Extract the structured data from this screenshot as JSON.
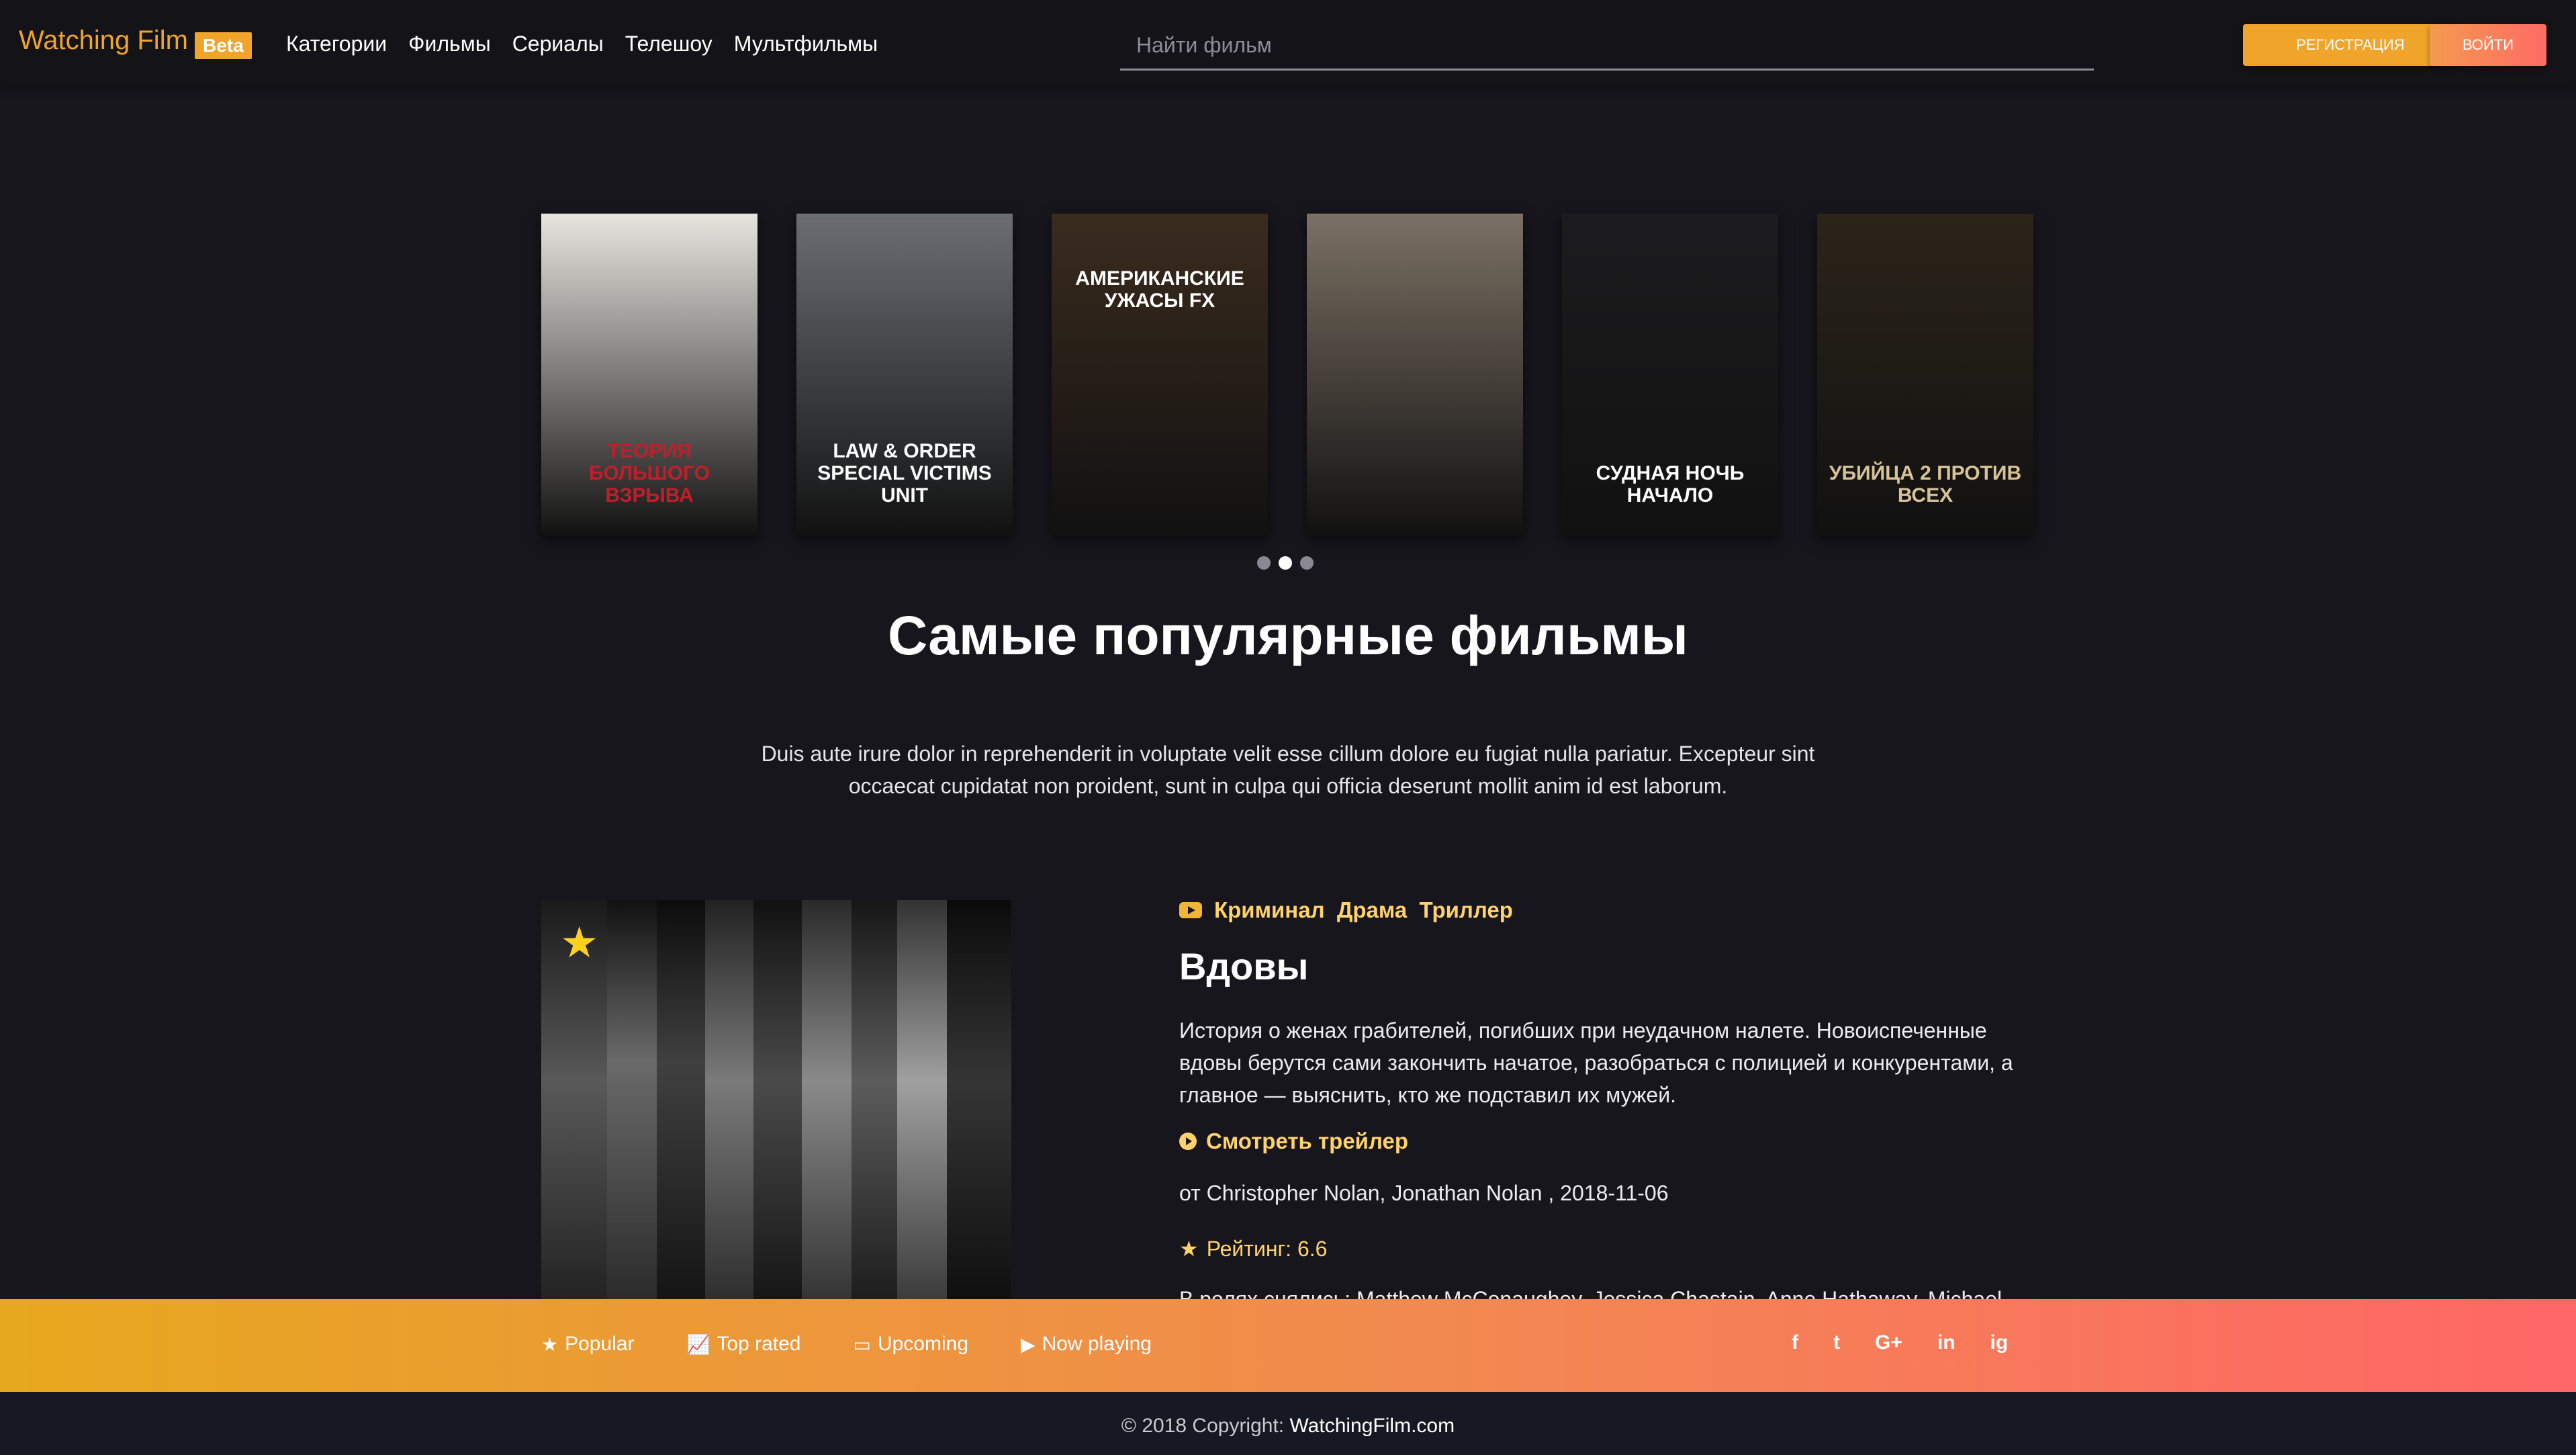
{
  "header": {
    "brand": "Watching Film",
    "badge": "Beta",
    "nav": [
      "Категории",
      "Фильмы",
      "Сериалы",
      "Телешоу",
      "Мультфильмы"
    ],
    "search_placeholder": "Найти фильм",
    "register_label": "РЕГИСТРАЦИЯ",
    "login_label": "ВОЙТИ"
  },
  "carousel": {
    "posters": [
      {
        "title": "ТЕОРИЯ БОЛЬШОГО ВЗРЫВА",
        "bg": "#e8e5df",
        "fg": "#c21e2a"
      },
      {
        "title": "LAW & ORDER SPECIAL VICTIMS UNIT",
        "bg": "#6a6e73",
        "fg": "#ffffff"
      },
      {
        "title": "АМЕРИКАНСКИЕ УЖАСЫ FX",
        "bg": "#3a2b1e",
        "fg": "#ffffff"
      },
      {
        "title": "",
        "bg": "#7b7063",
        "fg": "#ffffff"
      },
      {
        "title": "СУДНАЯ НОЧЬ НАЧАЛО",
        "bg": "#1c1c1e",
        "fg": "#ffffff"
      },
      {
        "title": "УБИЙЦА 2 ПРОТИВ ВСЕХ",
        "bg": "#2b2419",
        "fg": "#d8c398"
      }
    ],
    "active_dot": 1,
    "dot_count": 3
  },
  "section": {
    "title": "Самые популярные фильмы",
    "description": "Duis aute irure dolor in reprehenderit in voluptate velit esse cillum dolore eu fugiat nulla pariatur. Excepteur sint occaecat cupidatat non proident, sunt in culpa qui officia deserunt mollit anim id est laborum."
  },
  "film": {
    "genres": "Криминал  Драма  Триллер",
    "title": "Вдовы",
    "description": "История о женах грабителей, погибших при неудачном налете. Новоиспеченные вдовы берутся сами закончить начатое, разобраться с полицией и конкурентами, а главное — выяснить, кто же подставил их мужей.",
    "trailer_label": "Смотреть трейлер",
    "meta": "от Christopher Nolan, Jonathan Nolan , 2018-11-06",
    "rating": "Рейтинг: 6.6",
    "cast": "В ролях снялись: Matthew McConaughey, Jessica Chastain, Anne Hathaway, Michael"
  },
  "footer": {
    "links": [
      {
        "icon": "star-icon",
        "label": "Popular"
      },
      {
        "icon": "chart-icon",
        "label": "Top rated"
      },
      {
        "icon": "tv-icon",
        "label": "Upcoming"
      },
      {
        "icon": "play-icon",
        "label": "Now playing"
      }
    ],
    "socials": [
      "f",
      "t",
      "G+",
      "in",
      "ig"
    ],
    "copyright_prefix": "© 2018 Copyright:",
    "copyright_site": "WatchingFilm.com"
  },
  "colors": {
    "accent": "#f0a52a",
    "gold_text": "#ffd36a",
    "bg": "#17161d"
  }
}
